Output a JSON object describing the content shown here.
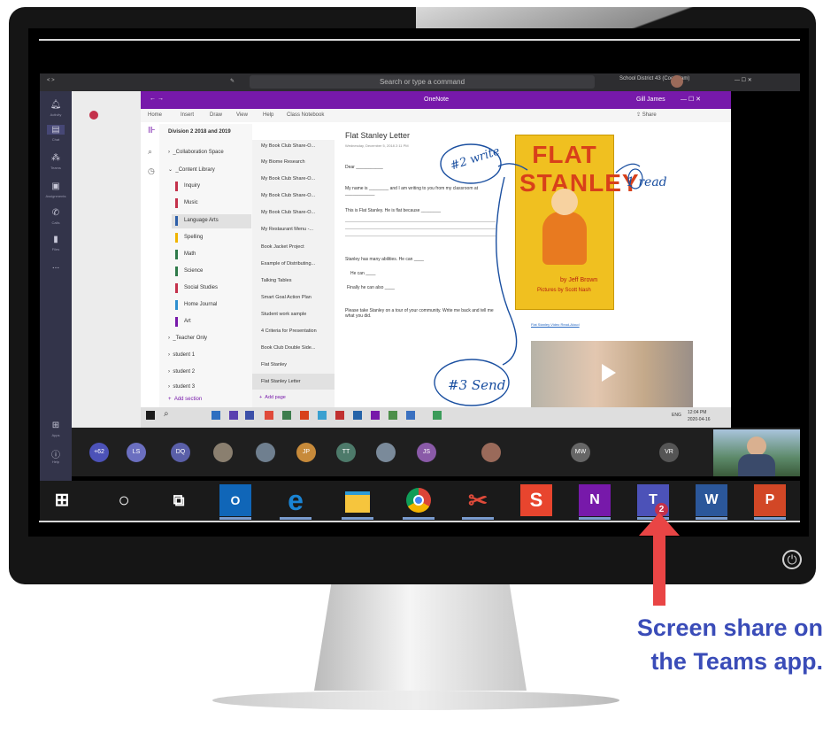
{
  "teams": {
    "search_placeholder": "Search or type a command",
    "org_name": "School District 43 (Coquitlam)",
    "rail": [
      {
        "icon": "bell-icon",
        "label": "Activity"
      },
      {
        "icon": "chat-icon",
        "label": "Chat"
      },
      {
        "icon": "teams-icon",
        "label": "Teams"
      },
      {
        "icon": "assignments-icon",
        "label": "Assignments"
      },
      {
        "icon": "calls-icon",
        "label": "Calls"
      },
      {
        "icon": "files-icon",
        "label": "Files"
      },
      {
        "icon": "more-icon",
        "label": "..."
      },
      {
        "icon": "apps-icon",
        "label": "Apps"
      },
      {
        "icon": "help-icon",
        "label": "Help"
      }
    ]
  },
  "onenote": {
    "app_title": "OneNote",
    "user": "Gill James",
    "menu": [
      "Home",
      "Insert",
      "Draw",
      "View",
      "Help",
      "Class Notebook"
    ],
    "share_label": "Share",
    "notebook": "Division 2 2018 and 2019",
    "sections": [
      "_Collaboration Space",
      "_Content Library",
      "Inquiry",
      "Music",
      "Language Arts",
      "Spelling",
      "Math",
      "Science",
      "Social Studies",
      "Home Journal",
      "Art",
      "_Teacher Only",
      "student 1",
      "student 2",
      "student 3"
    ],
    "add_section": "Add section",
    "pages": [
      "My Book Club Share-O...",
      "My Biome Research",
      "My Book Club Share-O...",
      "My Book Club Share-O...",
      "My Book Club Share-O...",
      "My Restaurant Menu -...",
      "Book Jacket Project",
      "Example of Distributing...",
      "Talking Tables",
      "Smart Goal Action Plan",
      "Student work sample",
      "4 Criteria for Presentation",
      "Book Club Double Side...",
      "Flat Stanley",
      "Flat Stanley Letter"
    ],
    "add_page": "Add page",
    "page_title": "Flat Stanley Letter",
    "page_date": "Wednesday, December 5, 2018   2:11 PM",
    "letter_lines": [
      "Dear ___________",
      "My name is ________ and I am writing to you from my classroom at ____________",
      "This is Flat Stanley. He is flat because ________",
      "Stanley has many abilities. He can ____",
      "He can ____",
      "Finally he can also ____",
      "Please take Stanley on a tour of your community. Write me back and tell me what you did."
    ],
    "link_text": "Flat Stanley Video Read-Aloud",
    "book_title": "FLAT STANLEY",
    "book_author": "by Jeff Brown",
    "book_illustrator": "Pictures by Scott Nash",
    "annotations": [
      "#2 write",
      "1 read",
      "#3 Send"
    ]
  },
  "shared_taskbar": {
    "time": "12:04 PM",
    "date": "2020-04-16",
    "lang": "ENG"
  },
  "participants": {
    "overflow": "+62",
    "initials": [
      "LS",
      "DQ",
      "JP",
      "TT",
      "JS",
      "MW",
      "VR"
    ],
    "colors": {
      "LS": "#6b6fc0",
      "DQ": "#5a5fa8",
      "JP": "#c78a3a",
      "TT": "#4d7a6a",
      "JS": "#8a5aa8",
      "MW": "#666",
      "VR": "#555",
      "overflow": "#4c52b8"
    }
  },
  "taskbar": {
    "items": [
      {
        "icon": "windows-start-icon"
      },
      {
        "icon": "cortana-icon"
      },
      {
        "icon": "task-view-icon"
      },
      {
        "icon": "outlook-icon",
        "label": "O"
      },
      {
        "icon": "edge-icon",
        "label": "e"
      },
      {
        "icon": "file-explorer-icon"
      },
      {
        "icon": "chrome-icon"
      },
      {
        "icon": "snipping-tool-icon"
      },
      {
        "icon": "snagit-icon",
        "label": "S"
      },
      {
        "icon": "onenote-icon",
        "label": "N"
      },
      {
        "icon": "teams-icon",
        "label": "T",
        "badge": "2"
      },
      {
        "icon": "word-icon",
        "label": "W"
      },
      {
        "icon": "powerpoint-icon",
        "label": "P"
      }
    ]
  },
  "caption": {
    "line1": "Screen share on",
    "line2": "the Teams app."
  },
  "colors": {
    "onenote_purple": "#7719aa",
    "teams_purple": "#4c52b8",
    "arrow_red": "#e94545",
    "caption_blue": "#3a4cb8"
  }
}
